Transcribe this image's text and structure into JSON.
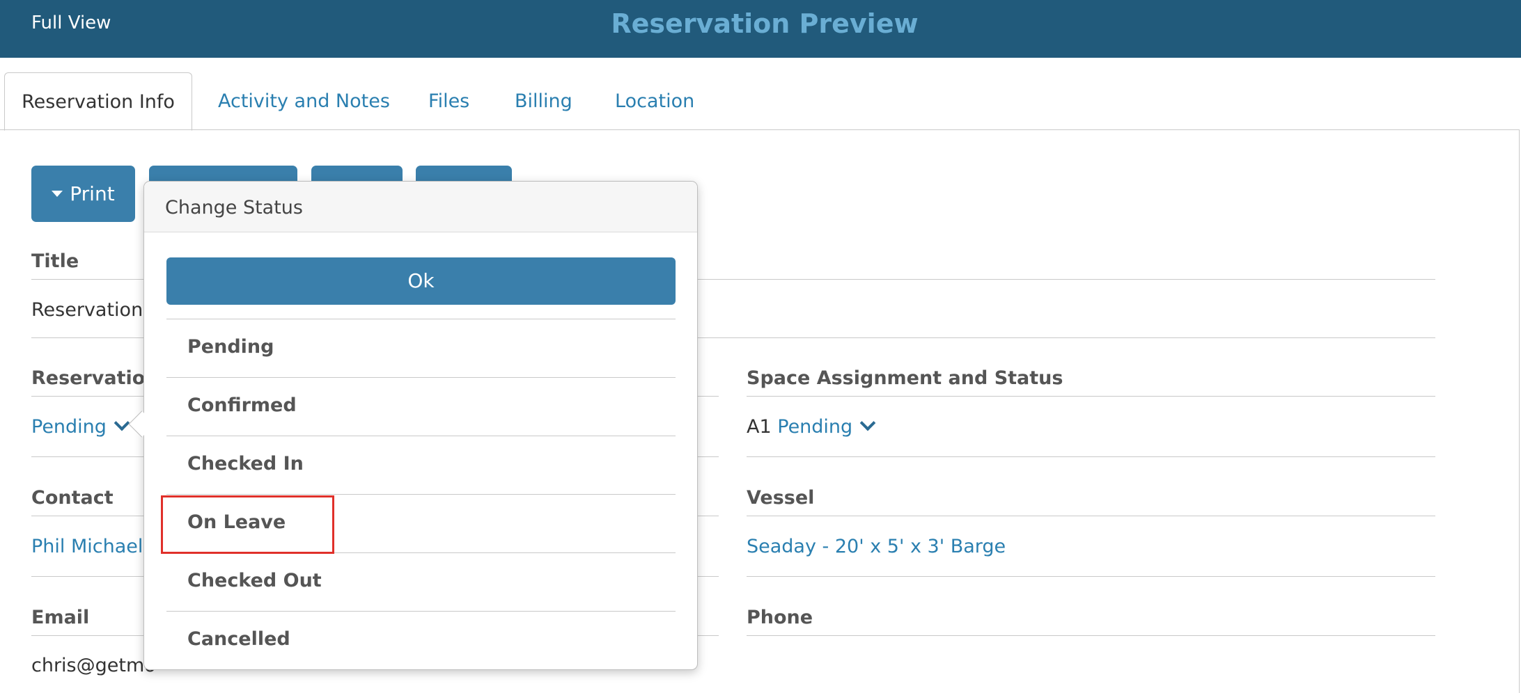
{
  "header": {
    "full_view_label": "Full View",
    "title": "Reservation Preview",
    "bg_color": "#215a7b",
    "title_color": "#6aaed4"
  },
  "tabs": [
    {
      "label": "Reservation Info",
      "active": true
    },
    {
      "label": "Activity and Notes",
      "active": false
    },
    {
      "label": "Files",
      "active": false
    },
    {
      "label": "Billing",
      "active": false
    },
    {
      "label": "Location",
      "active": false
    }
  ],
  "toolbar": {
    "print_label": "Print"
  },
  "fields": {
    "title_label": "Title",
    "title_value": "Reservation",
    "reservation_status_label": "Reservation",
    "reservation_status_value": "Pending",
    "space_label": "Space Assignment and Status",
    "space_id": "A1",
    "space_status": "Pending",
    "contact_label": "Contact",
    "contact_value": "Phil Michael",
    "vessel_label": "Vessel",
    "vessel_value": "Seaday - 20' x 5' x 3' Barge",
    "email_label": "Email",
    "email_value": "chris@getmo",
    "phone_label": "Phone"
  },
  "change_status_popover": {
    "title": "Change Status",
    "ok_label": "Ok",
    "options": [
      "Pending",
      "Confirmed",
      "Checked In",
      "On Leave",
      "Checked Out",
      "Cancelled"
    ],
    "highlighted_option": "On Leave"
  },
  "colors": {
    "accent": "#3a7fab",
    "link": "#2a7fb0",
    "highlight_box": "#e0302a"
  }
}
